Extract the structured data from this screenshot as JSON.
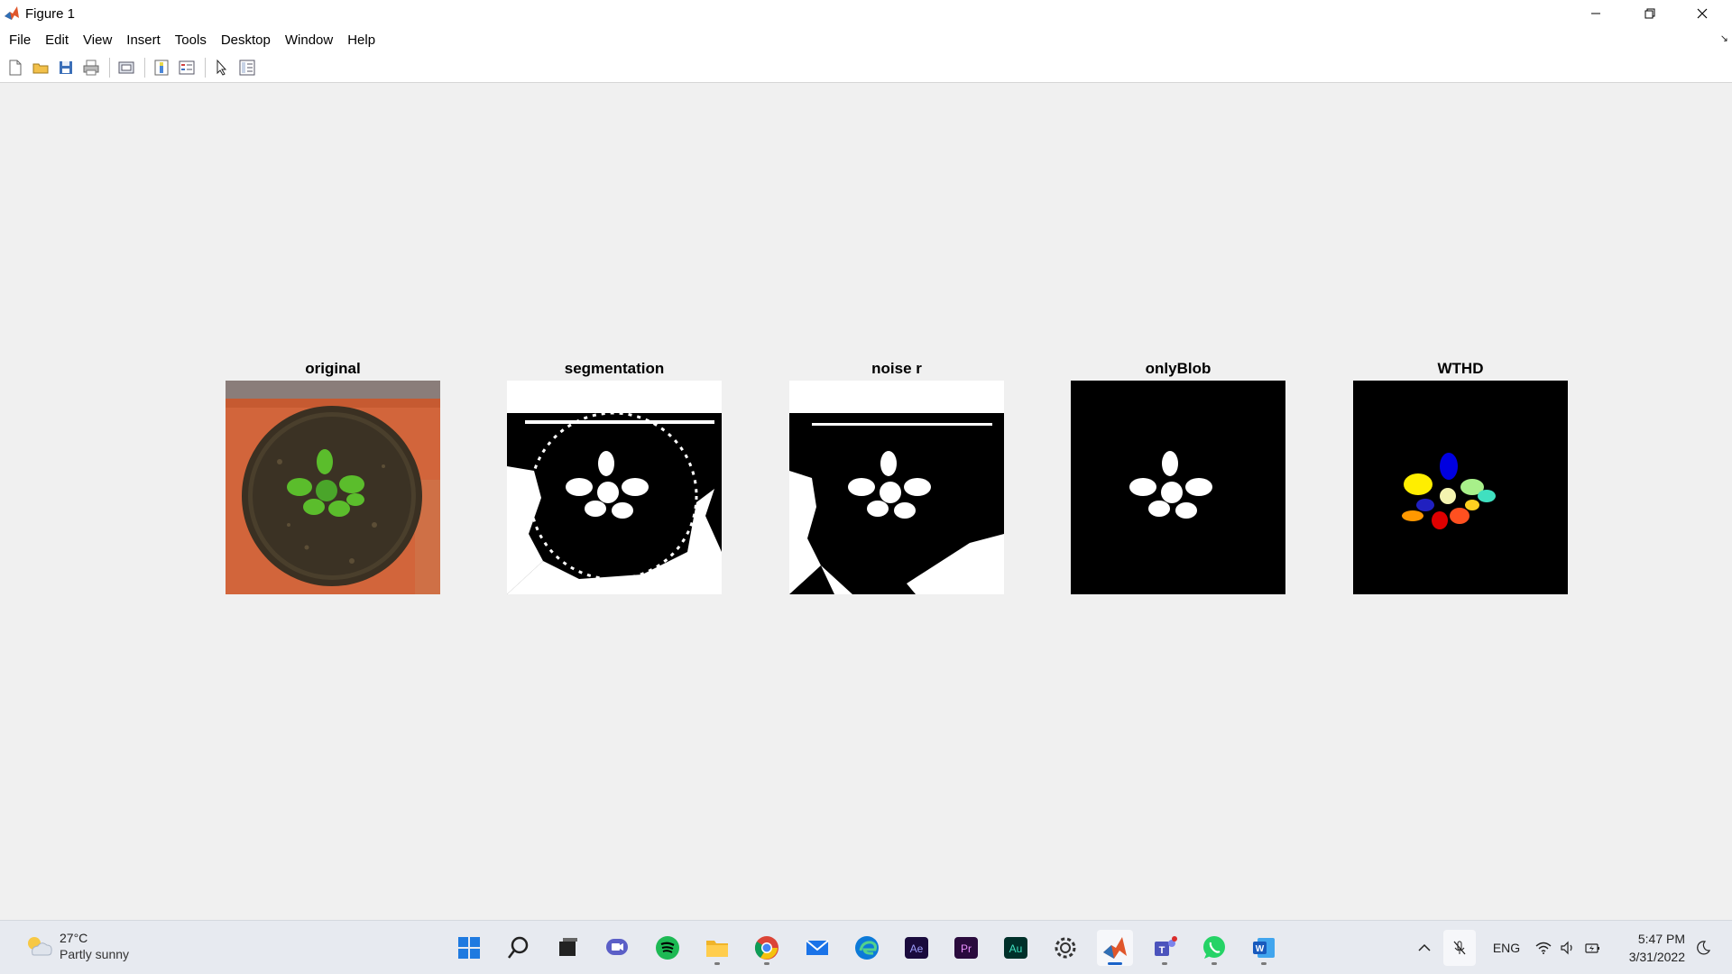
{
  "window": {
    "title": "Figure 1",
    "icon": "matlab-icon"
  },
  "menu": [
    {
      "label": "File"
    },
    {
      "label": "Edit"
    },
    {
      "label": "View"
    },
    {
      "label": "Insert"
    },
    {
      "label": "Tools"
    },
    {
      "label": "Desktop"
    },
    {
      "label": "Window"
    },
    {
      "label": "Help"
    }
  ],
  "toolbar": [
    {
      "icon": "new-figure-icon"
    },
    {
      "icon": "open-file-icon"
    },
    {
      "icon": "save-icon"
    },
    {
      "icon": "print-icon"
    },
    {
      "icon": "link-plot-icon"
    },
    {
      "icon": "insert-colorbar-icon"
    },
    {
      "icon": "insert-legend-icon"
    },
    {
      "icon": "edit-plot-arrow-icon"
    },
    {
      "icon": "property-inspector-icon"
    }
  ],
  "subplots": [
    {
      "title": "original"
    },
    {
      "title": "segmentation"
    },
    {
      "title": "noise r"
    },
    {
      "title": "onlyBlob"
    },
    {
      "title": "WTHD"
    }
  ],
  "taskbar": {
    "weather": {
      "temp": "27°C",
      "condition": "Partly sunny"
    },
    "apps": [
      "start",
      "search",
      "task-view",
      "chat",
      "spotify",
      "file-explorer",
      "chrome",
      "mail",
      "edge",
      "after-effects",
      "premiere-pro",
      "audition",
      "settings",
      "matlab",
      "teams",
      "whatsapp",
      "word"
    ],
    "tray": {
      "language": "ENG"
    },
    "clock": {
      "time": "5:47 PM",
      "date": "3/31/2022"
    }
  },
  "colors": {
    "figure_bg": "#f0f0f0",
    "pot_orange": "#d2653b",
    "soil": "#3b3224",
    "leaf_green": "#5bbd2c"
  }
}
